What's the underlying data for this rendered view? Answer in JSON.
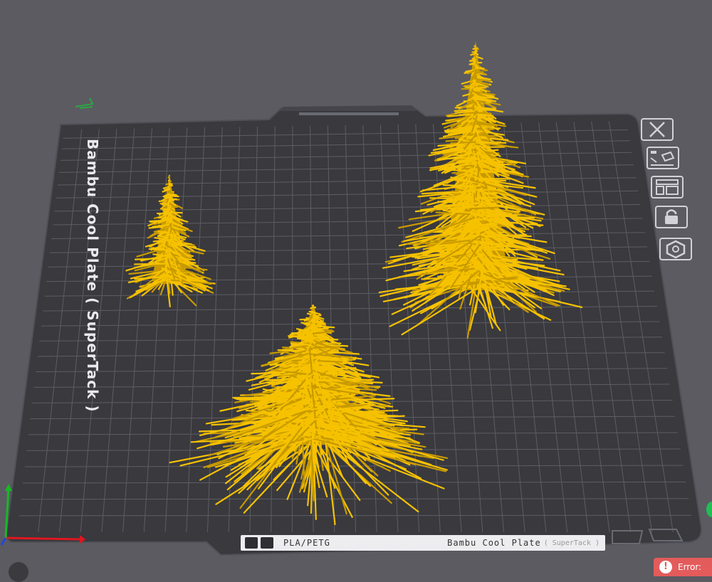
{
  "plate": {
    "side_label": "Bambu Cool Plate ( SuperTack )",
    "filament": "PLA/PETG",
    "plate_name": "Bambu Cool Plate",
    "plate_sub": "( SuperTack )"
  },
  "toolbar": {
    "buttons": [
      {
        "name": "close-icon"
      },
      {
        "name": "pick-object-icon"
      },
      {
        "name": "arrange-icon"
      },
      {
        "name": "lock-icon"
      },
      {
        "name": "settings-hex-icon"
      }
    ]
  },
  "status": {
    "error_label": "Error:",
    "error_icon": "!"
  },
  "colors": {
    "background": "#5b5b61",
    "plate": "#39393e",
    "grid": "#5e5e66",
    "model": "#f6c200",
    "model_shadow": "#c89a00",
    "error": "#e45b5b"
  },
  "icons": [
    "close-icon",
    "pick-object-icon",
    "arrange-icon",
    "lock-icon",
    "settings-hex-icon",
    "axis-gizmo-icon",
    "camera-icon",
    "error-icon"
  ]
}
